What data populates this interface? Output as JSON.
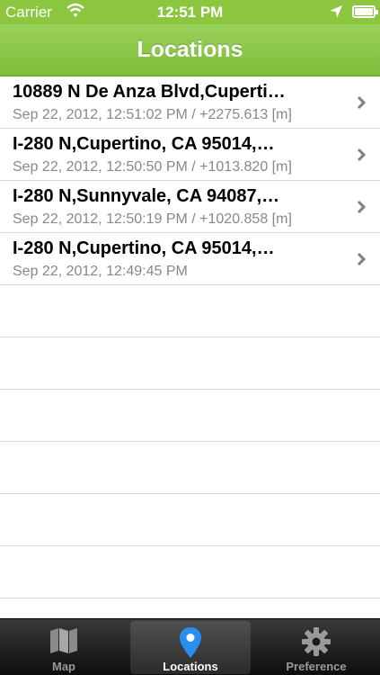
{
  "status_bar": {
    "carrier": "Carrier",
    "time": "12:51 PM",
    "battery_level": 0.9,
    "icons": [
      "wifi-icon",
      "location-arrow-icon",
      "battery-icon"
    ]
  },
  "nav_bar": {
    "title": "Locations"
  },
  "locations": [
    {
      "address": "10889 N De Anza Blvd,Cuperti…",
      "detail": "Sep 22, 2012, 12:51:02 PM / +2275.613 [m]"
    },
    {
      "address": "I-280 N,Cupertino, CA  95014,…",
      "detail": "Sep 22, 2012, 12:50:50 PM / +1013.820 [m]"
    },
    {
      "address": "I-280 N,Sunnyvale, CA  94087,…",
      "detail": "Sep 22, 2012, 12:50:19 PM / +1020.858 [m]"
    },
    {
      "address": "I-280 N,Cupertino, CA  95014,…",
      "detail": "Sep 22, 2012, 12:49:45 PM"
    }
  ],
  "tab_bar": {
    "tabs": [
      {
        "label": "Map",
        "icon": "map-icon"
      },
      {
        "label": "Locations",
        "icon": "location-pin-icon"
      },
      {
        "label": "Preference",
        "icon": "gear-icon"
      }
    ],
    "selected": "Locations"
  },
  "colors": {
    "accent_green": "#8cc63f",
    "pin_blue": "#2a8ef0",
    "tab_bar_dark": "#1a1a1a"
  }
}
